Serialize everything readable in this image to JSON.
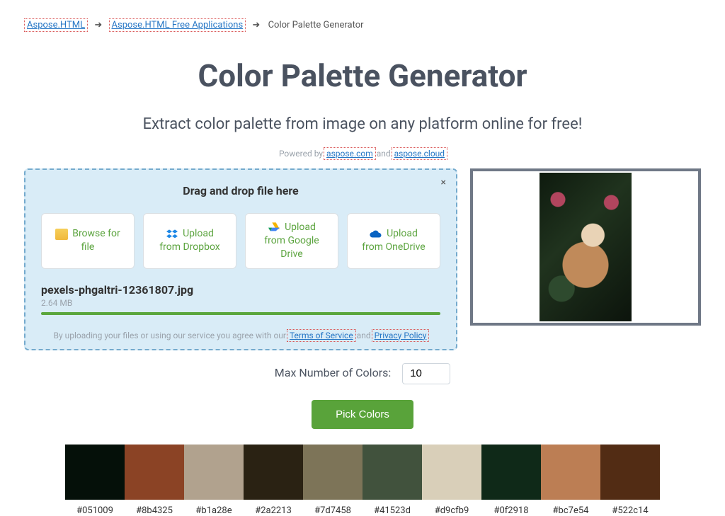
{
  "breadcrumb": {
    "link1": "Aspose.HTML",
    "link2": "Aspose.HTML Free Applications",
    "current": "Color Palette Generator",
    "arrow": "➜"
  },
  "title": "Color Palette Generator",
  "subtitle": "Extract color palette from image on any platform online for free!",
  "poweredby": {
    "prefix": "Powered by ",
    "link1": "aspose.com",
    "and": " and ",
    "link2": "aspose.cloud"
  },
  "dropzone": {
    "heading": "Drag and drop file here",
    "close": "×",
    "buttons": [
      {
        "label1": "Browse for",
        "label2": "file"
      },
      {
        "label1": "Upload",
        "label2": "from Dropbox"
      },
      {
        "label1": "Upload",
        "label2": "from Google",
        "label3": "Drive"
      },
      {
        "label1": "Upload",
        "label2": "from OneDrive"
      }
    ],
    "file": {
      "name": "pexels-phgaltri-12361807.jpg",
      "size": "2.64 MB"
    },
    "disclaimer": {
      "prefix": "By uploading your files or using our service you agree with our ",
      "tos": "Terms of Service",
      "and": " and ",
      "pp": "Privacy Policy"
    }
  },
  "controls": {
    "label": "Max Number of Colors:",
    "value": "10",
    "button": "Pick Colors"
  },
  "palette": {
    "colors": [
      "#051009",
      "#8b4325",
      "#b1a28e",
      "#2a2213",
      "#7d7458",
      "#41523d",
      "#d9cfb9",
      "#0f2918",
      "#bc7e54",
      "#522c14"
    ]
  }
}
